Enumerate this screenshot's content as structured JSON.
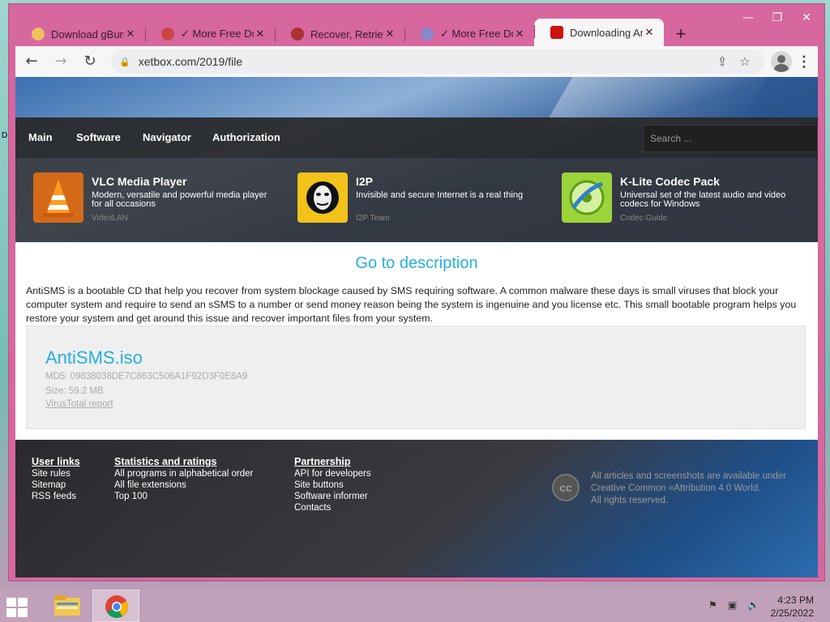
{
  "browser": {
    "tabs": [
      {
        "title": "Download gBurner",
        "favicon_color": "#f0c060"
      },
      {
        "title": "✓ More Free Dow",
        "favicon_color": "#cc4444"
      },
      {
        "title": "Recover, Retrieve",
        "favicon_color": "#aa3333"
      },
      {
        "title": "✓ More Free Dow",
        "favicon_color": "#8888cc"
      },
      {
        "title": "Downloading Anti",
        "favicon_color": "#cc1111"
      }
    ],
    "url": "xetbox.com/2019/file",
    "new_tab_glyph": "+",
    "close_glyph": "✕"
  },
  "site": {
    "menu": [
      "Main",
      "Software",
      "Navigator",
      "Authorization"
    ],
    "search_placeholder": "Search ...",
    "promos": [
      {
        "title": "VLC Media Player",
        "desc": "Modern, versatile and powerful media player for all occasions",
        "vendor": "VideoLAN",
        "icon": "vlc-cone-icon"
      },
      {
        "title": "I2P",
        "desc": "Invisible and secure Internet is a real thing",
        "vendor": "I2P Team",
        "icon": "i2p-mask-icon"
      },
      {
        "title": "K-Lite Codec Pack",
        "desc": "Universal set of the latest audio and video codecs for Windows",
        "vendor": "Codec Guide",
        "icon": "klite-icon"
      }
    ],
    "goto_label": "Go to description",
    "description": "AntiSMS is a bootable CD that help you recover from system blockage caused by SMS requiring software. A common malware these days is small viruses that block your computer system and require to send an sSMS to a number or send money reason being the system is ingenuine and you license etc. This small bootable program helps you restore your system and get around this issue and recover important files from your system.",
    "file": {
      "name": "AntiSMS.iso",
      "md5": "MD5: 09838038DE7C863C506A1F92D3F0E8A9",
      "size": "Size: 59.2 MB",
      "report": "VirusTotal report"
    },
    "footer": {
      "columns": [
        {
          "heading": "User links",
          "links": [
            "Site rules",
            "Sitemap",
            "RSS feeds"
          ]
        },
        {
          "heading": "Statistics and ratings",
          "links": [
            "All programs in alphabetical order",
            "All file extensions",
            "Top 100"
          ]
        },
        {
          "heading": "Partnership",
          "links": [
            "API for developers",
            "Site buttons",
            "Software informer",
            "Contacts"
          ]
        }
      ],
      "cc_badge": "cc",
      "cc_text_1": "All articles and screenshots are available under",
      "cc_text_2": "Creative Common «Attribution 4.0 World.",
      "cc_text_3": "All rights reserved."
    }
  },
  "taskbar": {
    "time": "4:23 PM",
    "date": "2/25/2022"
  },
  "colors": {
    "accent": "#25aee0",
    "frame": "#d6679f",
    "taskbar": "#c1a0ba"
  }
}
